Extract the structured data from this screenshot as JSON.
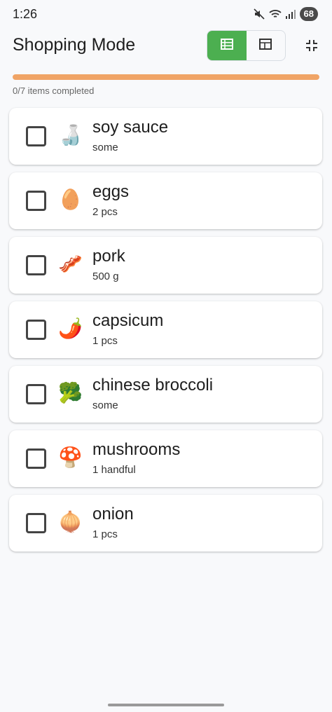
{
  "status_bar": {
    "time": "1:26",
    "battery": "68"
  },
  "header": {
    "title": "Shopping Mode",
    "view_toggle": {
      "active": "list",
      "options": [
        "list-view-icon",
        "grid-view-icon"
      ]
    },
    "exit_icon": "fullscreen-exit-icon"
  },
  "progress": {
    "completed": 0,
    "total": 7,
    "fraction": 0,
    "text": "0/7 items completed"
  },
  "colors": {
    "accent": "#4caf50",
    "progress": "#f0a466",
    "progress_track": "#fbe0c7",
    "background": "#f8f9fb"
  },
  "items": [
    {
      "name": "soy sauce",
      "qty": "some",
      "emoji": "🍶",
      "checked": false
    },
    {
      "name": "eggs",
      "qty": "2 pcs",
      "emoji": "🥚",
      "checked": false
    },
    {
      "name": "pork",
      "qty": "500 g",
      "emoji": "🥓",
      "checked": false
    },
    {
      "name": "capsicum",
      "qty": "1 pcs",
      "emoji": "🌶️",
      "checked": false
    },
    {
      "name": "chinese broccoli",
      "qty": "some",
      "emoji": "🥦",
      "checked": false
    },
    {
      "name": "mushrooms",
      "qty": "1 handful",
      "emoji": "🍄",
      "checked": false
    },
    {
      "name": "onion",
      "qty": "1 pcs",
      "emoji": "🧅",
      "checked": false
    }
  ]
}
